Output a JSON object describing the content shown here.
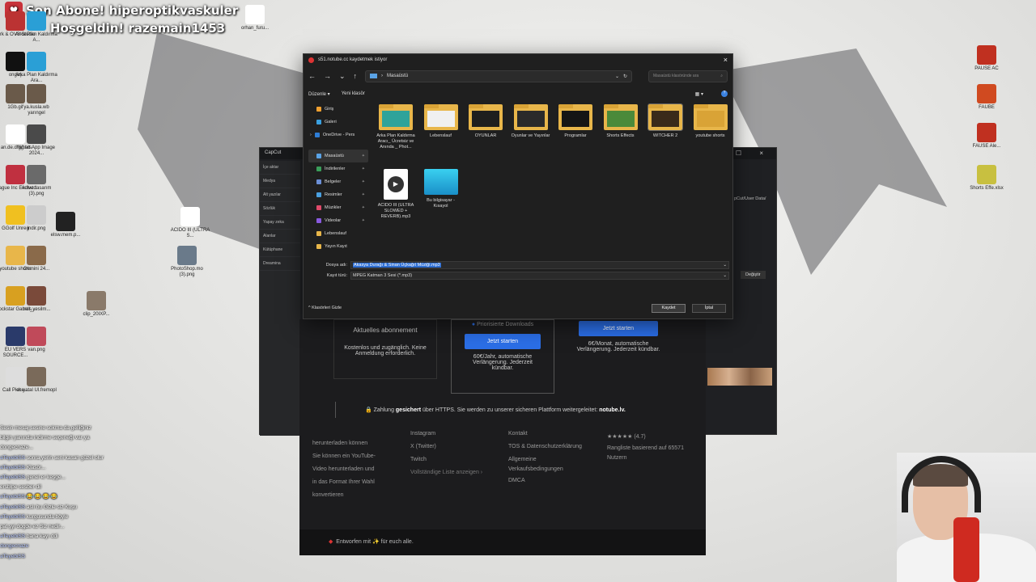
{
  "overlay": {
    "line1": "Son Abone! hiperoptikvaskuler",
    "line2": "Hoşgeldin! razemain1453"
  },
  "desktop_icons_left": [
    {
      "label": "Sirk & OVS Studio"
    },
    {
      "label": "Arka Plan Kaldırma A..."
    },
    {
      "label": "orhan_furu..."
    },
    {
      "label": "ongeş"
    },
    {
      "label": "Arka Plan Kaldırma Ara..."
    },
    {
      "label": "1Gb.gif"
    },
    {
      "label": "ya.kusla.wb yarıngel"
    },
    {
      "label": "an.de.dfgg.txt"
    },
    {
      "label": "WhatsApp Image 2024..."
    },
    {
      "label": "Plague Inc Evolved"
    },
    {
      "label": "Adsız tasarım (3).png"
    },
    {
      "label": "GGolf Unreg"
    },
    {
      "label": "indir.png"
    },
    {
      "label": "elsw.mem.p..."
    },
    {
      "label": "ACIDO III (ULTRA S..."
    },
    {
      "label": "youtube shorts"
    },
    {
      "label": "Gemini 24..."
    },
    {
      "label": "PhotoShop.mo (3).png"
    },
    {
      "label": "Rockstar Games..."
    },
    {
      "label": "bell_yesilm..."
    },
    {
      "label": "clip_20IXP..."
    },
    {
      "label": "EU VERS SOURCE..."
    },
    {
      "label": "van.png"
    },
    {
      "label": "Call Piece..."
    },
    {
      "label": "ch.yatal Ul.fremopl"
    }
  ],
  "desktop_icons_right": [
    {
      "label": "PAUSE AC"
    },
    {
      "label": "FAUBE"
    },
    {
      "label": "FAUSE Ale..."
    },
    {
      "label": "Shorts Effe.xlsx"
    }
  ],
  "dialog": {
    "title": "s51.notube.cc kaydetmek istiyor",
    "close": "×",
    "nav": {
      "back": "←",
      "forward": "→",
      "down": "⌄",
      "up": "↑",
      "path": "Masaüstü",
      "path_sep": "›",
      "refresh": "↻",
      "search_placeholder": "Masaüstü klasöründe ara",
      "search_icon": "⌕"
    },
    "commands": {
      "organize": "Düzenle ▾",
      "new_folder": "Yeni klasör",
      "view": "▦ ▾",
      "help": "?"
    },
    "nav_pane": [
      {
        "label": "Giriş",
        "color": "#f0a030"
      },
      {
        "label": "Galeri",
        "color": "#3aa0e0"
      },
      {
        "label": "OneDrive - Pers",
        "color": "#2e7dd6",
        "expand": "›"
      },
      {
        "label": "Masaüstü",
        "color": "#5aa3e6",
        "selected": true,
        "pin": "✦"
      },
      {
        "label": "İndirilenler",
        "color": "#3a9e5a",
        "pin": "✦"
      },
      {
        "label": "Belgeler",
        "color": "#6b8fd6",
        "pin": "✦"
      },
      {
        "label": "Resimler",
        "color": "#4aa0e0",
        "pin": "✦"
      },
      {
        "label": "Müzikler",
        "color": "#e04a6a",
        "pin": "✦"
      },
      {
        "label": "Videolar",
        "color": "#8a5ae0",
        "pin": "✦"
      },
      {
        "label": "Lebenslauf",
        "color": "#e8b64a"
      },
      {
        "label": "Yayın Kayıt",
        "color": "#e8b64a"
      }
    ],
    "files": [
      {
        "name": "Arka Plan Kaldırma Aracı_ Ücretsiz ve Anında _ Phot...",
        "kind": "folder",
        "thumb": "#2fa39a"
      },
      {
        "name": "Lebenslauf",
        "kind": "folder",
        "thumb": "#f0f0f0"
      },
      {
        "name": "OYUNLAR",
        "kind": "folder",
        "thumb": "#1e1e1e"
      },
      {
        "name": "Oyunlar ve Yayınlar",
        "kind": "folder",
        "thumb": "#2a2a2a"
      },
      {
        "name": "Programlar",
        "kind": "folder",
        "thumb": "#151515"
      },
      {
        "name": "Shorts Effects",
        "kind": "folder",
        "thumb": "#4b8a3a"
      },
      {
        "name": "WITCHER 2",
        "kind": "folder",
        "thumb": "#3a2a1a",
        "selected": true
      },
      {
        "name": "youtube shorts",
        "kind": "folder",
        "thumb": "#d9a336"
      },
      {
        "name": "ACIDO III (ULTRA SLOWED + REVERB).mp3",
        "kind": "mp3"
      },
      {
        "name": "Bu bilgisayar - Kısayol",
        "kind": "pc"
      }
    ],
    "file_name_label": "Dosya adı:",
    "file_name_value": "Akasya Durağı & Sinan Üçkağıt Müziği.mp3",
    "file_type_label": "Kayıt türü:",
    "file_type_value": "MPEG Katman 3 Sesi (*.mp3)",
    "hide_folders": "Klasörleri Gizle",
    "save_button": "Kaydet",
    "cancel_button": "İptal"
  },
  "capcut": {
    "title": "CapCut",
    "sidebar": [
      "İçe aktar",
      "Medya",
      "Alt yazılar",
      "Sözlük",
      "Yapay zeka",
      "Alanlar",
      "Kütüphane",
      "Dreamina"
    ],
    "path_fragment": "pCut/User Data/",
    "change": "Değiştir"
  },
  "web": {
    "plan1_title": "Aktuelles abonnement",
    "plan1_desc": "Kostenlos und zugänglich. Keine Anmeldung erforderlich.",
    "plan2_feature": "Priorisierte Downloads",
    "plan2_btn": "Jetzt starten",
    "plan2_desc": "60€/Jahr, automatische Verlängerung. Jederzeit kündbar.",
    "plan3_btn": "Jetzt starten",
    "plan3_desc": "6€/Monat, automatische Verlängerung. Jederzeit kündbar.",
    "secure_pre": "🔒 Zahlung ",
    "secure_bold": "gesichert",
    "secure_post": " über HTTPS. Sie werden zu unserer sicheren Plattform weitergeleitet: ",
    "secure_site": "notube.lv.",
    "col1": [
      "herunterladen können",
      "",
      "Sie können ein YouTube-",
      "Video herunterladen und",
      "in das Format Ihrer Wahl",
      "konvertieren"
    ],
    "col2": [
      "Instagram",
      "X (Twitter)",
      "Twitch",
      "Vollständige Liste anzeigen ›"
    ],
    "col3": [
      "Kontakt",
      "TOS & Datenschutzerklärung",
      "Allgemeine",
      "Verkaufsbedingungen",
      "DMCA"
    ],
    "rating_stars": "★★★★★ (4.7)",
    "rating_text": "Rangliste basierend auf 65571 Nutzern",
    "footer": "Entworfen mit ✨ für euch alle."
  },
  "chat": [
    {
      "user": "",
      "msg": "Sesin mesaj sesine sokma da gelliğiniz"
    },
    {
      "user": "",
      "msg": "bilgin yanında indirme seçeneği var ya"
    },
    {
      "user": "",
      "msg": "dongecnaze..."
    },
    {
      "user": "aTeyebiSS",
      "msg": "sonra yerin seni kasan güzel olur"
    },
    {
      "user": "aTeyebiSS",
      "msg": "Klasör..."
    },
    {
      "user": "aTeyebiSS",
      "msg": "genel er keşge..."
    },
    {
      "user": "",
      "msg": "ersblpe sesber dil"
    },
    {
      "user": "aTeyebiSS",
      "msg": "😂 😂 😂 😂"
    },
    {
      "user": "aTeyebiSS",
      "msg": "aslı bu Gizle siz Kuşu"
    },
    {
      "user": "aTeyebiSS",
      "msg": "kurgusunda böyle"
    },
    {
      "user": "",
      "msg": "pat şyi dogde ez Siz nedir..."
    },
    {
      "user": "aTeyebiSS",
      "msg": "bana kayı ddi"
    },
    {
      "user": "dongecnaze",
      "msg": ""
    },
    {
      "user": "aTeyebiSS",
      "msg": ""
    }
  ]
}
